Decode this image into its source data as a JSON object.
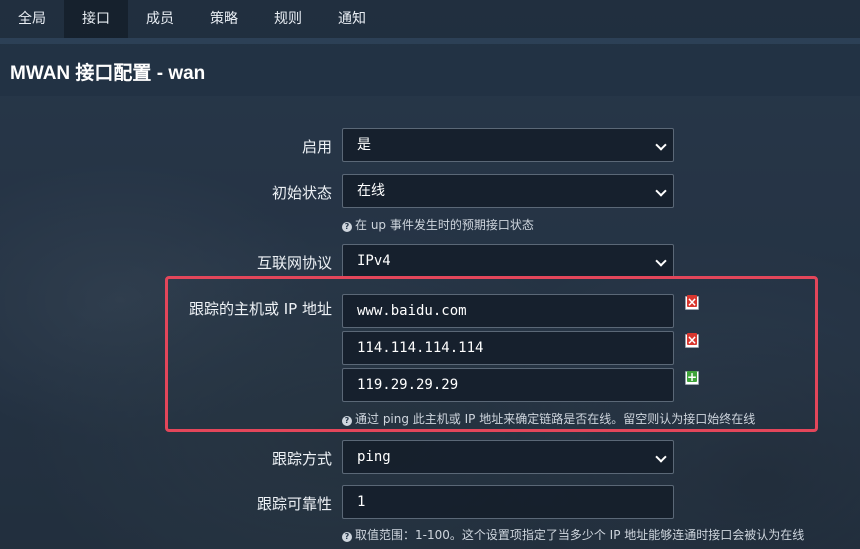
{
  "nav": {
    "items": [
      {
        "label": "全局",
        "active": false
      },
      {
        "label": "接口",
        "active": true
      },
      {
        "label": "成员",
        "active": false
      },
      {
        "label": "策略",
        "active": false
      },
      {
        "label": "规则",
        "active": false
      },
      {
        "label": "通知",
        "active": false
      }
    ]
  },
  "page": {
    "title": "MWAN 接口配置 - wan"
  },
  "form": {
    "enabled": {
      "label": "启用",
      "value": "是"
    },
    "initial_state": {
      "label": "初始状态",
      "value": "在线",
      "hint": "在 up 事件发生时的预期接口状态"
    },
    "protocol": {
      "label": "互联网协议",
      "value": "IPv4"
    },
    "track_hosts": {
      "label": "跟踪的主机或 IP 地址",
      "values": [
        "www.baidu.com",
        "114.114.114.114",
        "119.29.29.29"
      ],
      "hint": "通过 ping 此主机或 IP 地址来确定链路是否在线。留空则认为接口始终在线"
    },
    "track_method": {
      "label": "跟踪方式",
      "value": "ping"
    },
    "reliability": {
      "label": "跟踪可靠性",
      "value": "1",
      "hint": "取值范围：1-100。这个设置项指定了当多少个 IP 地址能够连通时接口会被认为在线"
    }
  },
  "icons": {
    "hint": "question-circle-icon",
    "remove": "remove-entry-icon",
    "add": "add-entry-icon",
    "dropdown": "chevron-down-icon"
  },
  "colors": {
    "highlight_border": "#e3465a",
    "remove_icon": "#d9372f",
    "add_icon": "#3fa33a"
  }
}
